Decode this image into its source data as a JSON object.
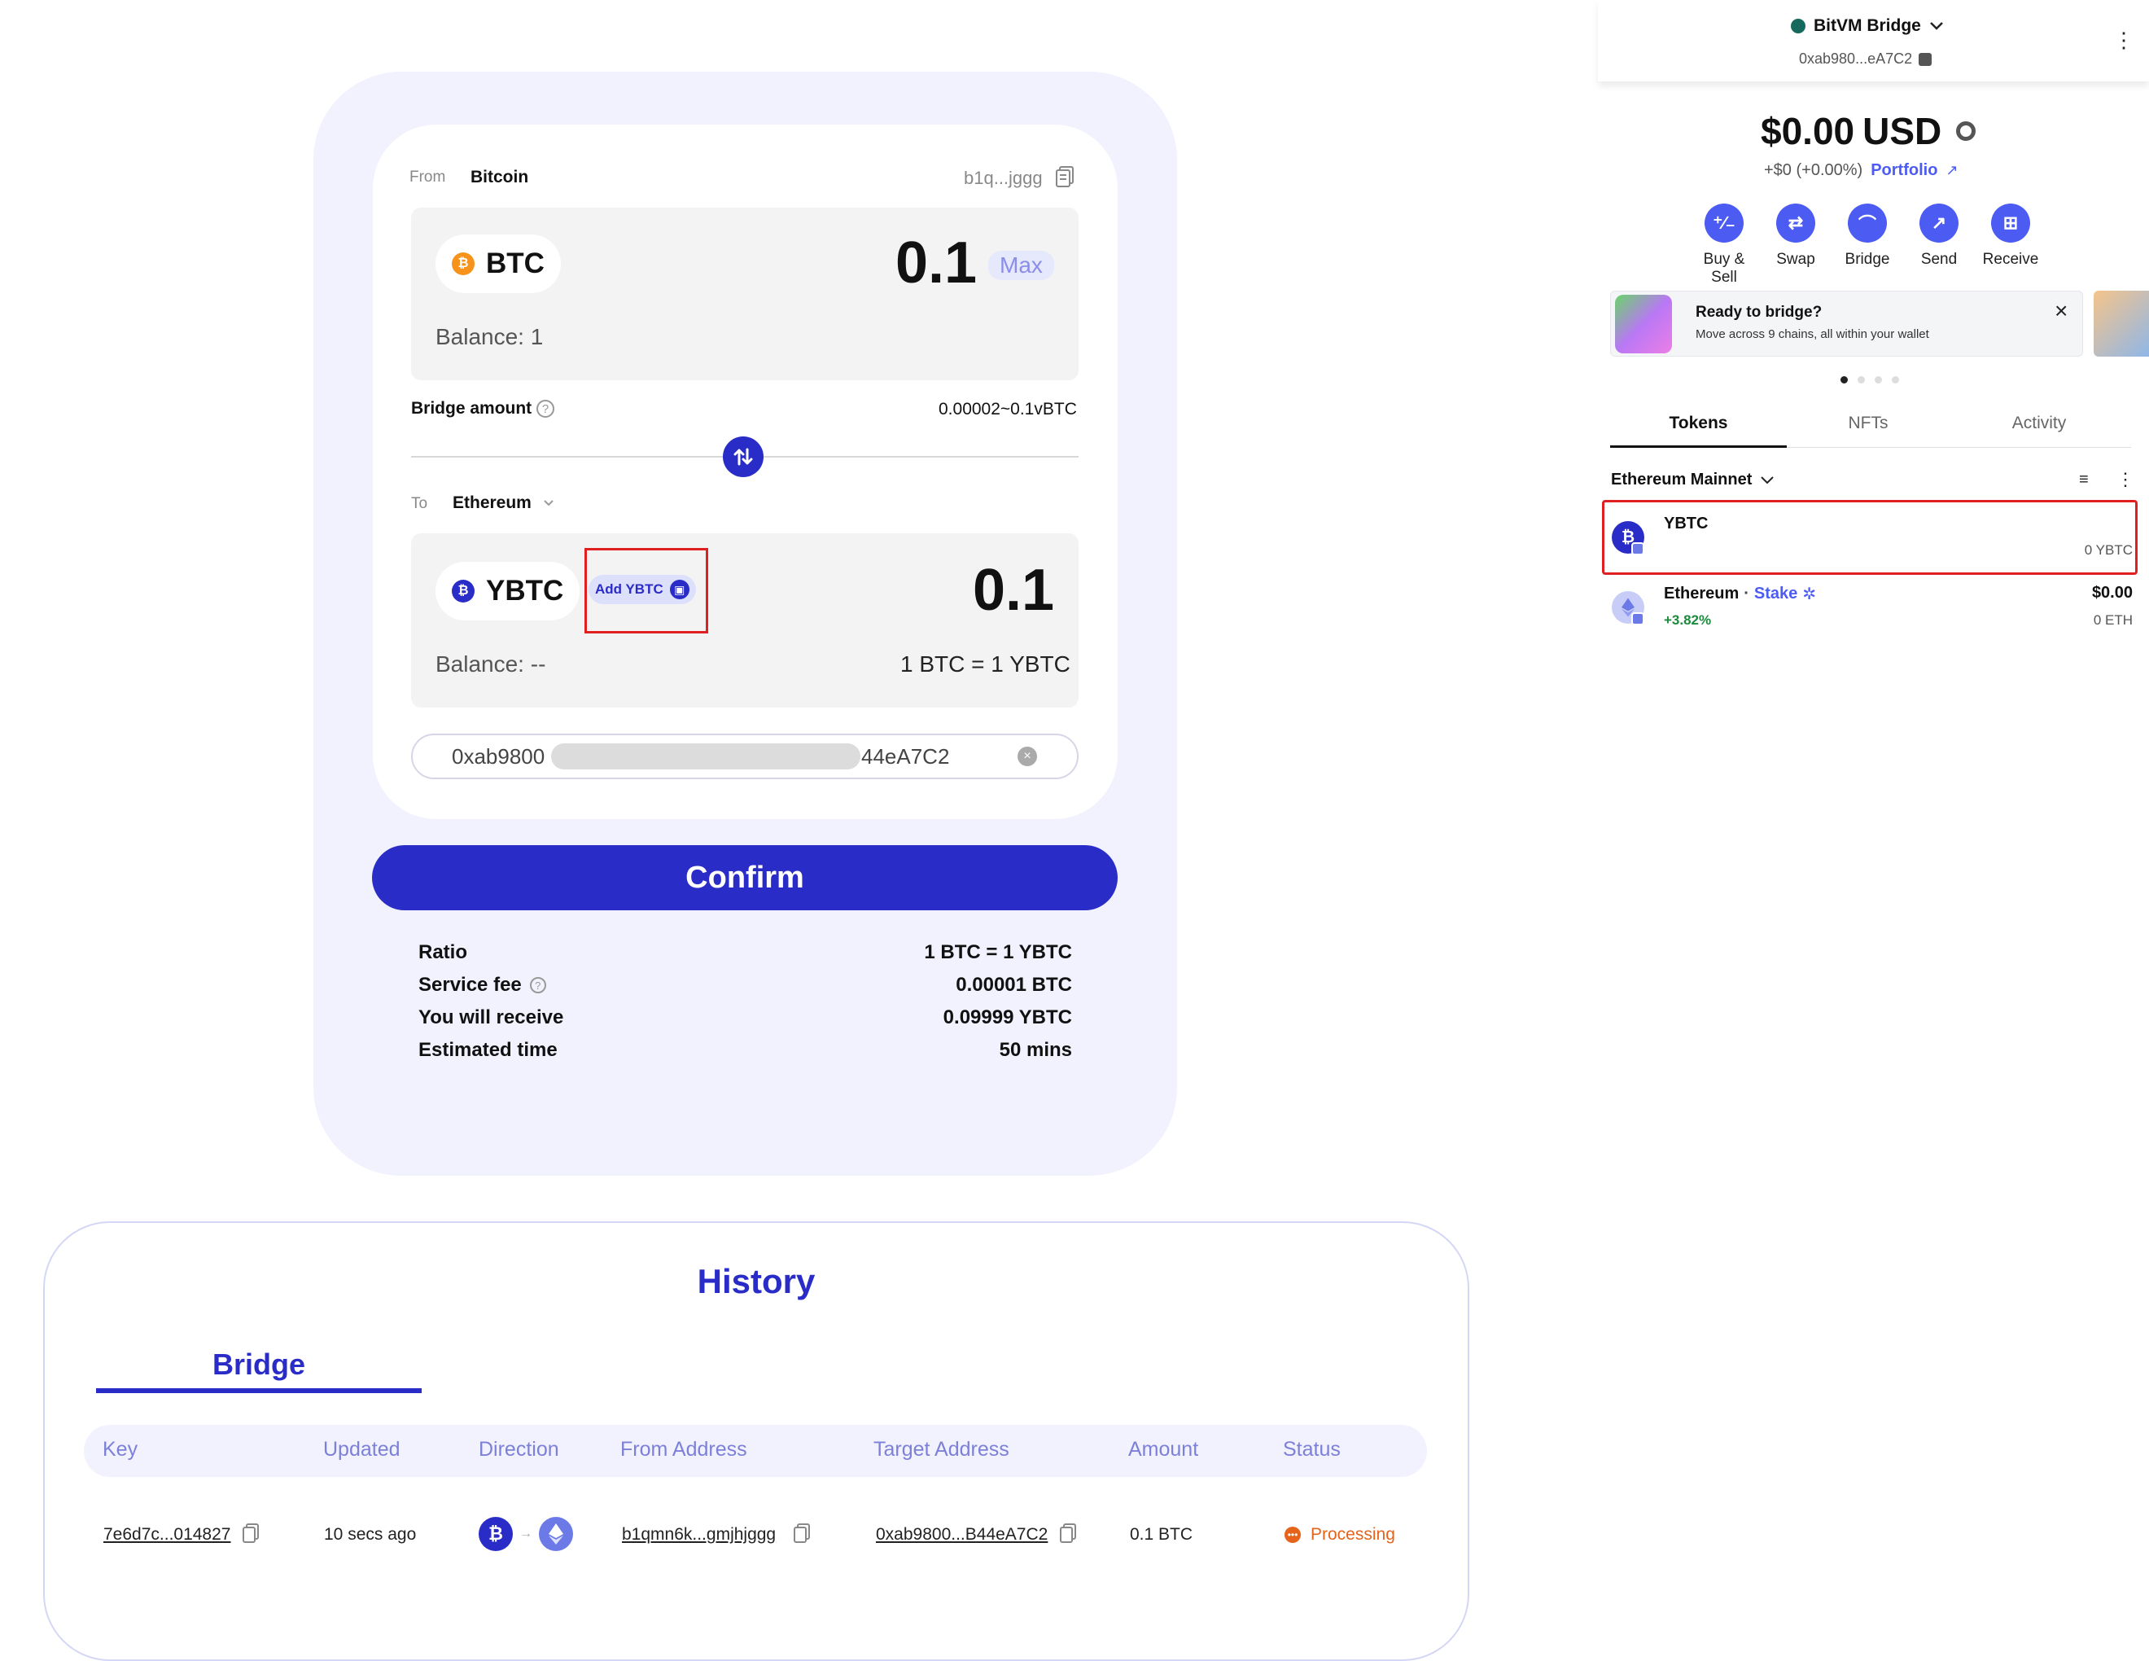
{
  "bridge": {
    "from_label": "From",
    "from_chain": "Bitcoin",
    "from_address": "b1q...jggg",
    "from_token": "BTC",
    "from_amount": "0.1",
    "max_label": "Max",
    "from_balance": "Balance: 1",
    "bridge_amount_label": "Bridge amount",
    "bridge_range": "0.00002~0.1vBTC",
    "to_label": "To",
    "to_chain": "Ethereum",
    "to_token": "YBTC",
    "add_token_label": "Add YBTC",
    "to_amount": "0.1",
    "to_balance": "Balance: --",
    "rate": "1 BTC = 1 YBTC",
    "recipient_prefix": "0xab9800",
    "recipient_suffix": "44eA7C2",
    "confirm_label": "Confirm"
  },
  "summary": [
    {
      "label": "Ratio",
      "value": "1 BTC = 1 YBTC"
    },
    {
      "label": "Service fee",
      "value": "0.00001 BTC"
    },
    {
      "label": "You will receive",
      "value": "0.09999 YBTC"
    },
    {
      "label": "Estimated time",
      "value": "50 mins"
    }
  ],
  "history": {
    "title": "History",
    "tab": "Bridge",
    "columns": [
      "Key",
      "Updated",
      "Direction",
      "From Address",
      "Target Address",
      "Amount",
      "Status"
    ],
    "rows": [
      {
        "key": "7e6d7c...014827",
        "updated": "10 secs ago",
        "from_address": "b1qmn6k...gmjhjggg",
        "target_address": "0xab9800...B44eA7C2",
        "amount": "0.1 BTC",
        "status": "Processing"
      }
    ]
  },
  "wallet": {
    "network_name": "BitVM Bridge",
    "account_address": "0xab980...eA7C2",
    "balance": "$0.00",
    "currency": "USD",
    "change": "+$0 (+0.00%)",
    "portfolio_label": "Portfolio",
    "actions": [
      {
        "label": "Buy & Sell",
        "icon": "buy-sell-icon"
      },
      {
        "label": "Swap",
        "icon": "swap-icon"
      },
      {
        "label": "Bridge",
        "icon": "bridge-icon"
      },
      {
        "label": "Send",
        "icon": "send-icon"
      },
      {
        "label": "Receive",
        "icon": "receive-icon"
      }
    ],
    "banner_title": "Ready to bridge?",
    "banner_text": "Move across 9 chains, all within your wallet",
    "tabs": [
      "Tokens",
      "NFTs",
      "Activity"
    ],
    "network_filter": "Ethereum Mainnet",
    "tokens": [
      {
        "name": "YBTC",
        "balance": "0 YBTC",
        "value": "",
        "change": ""
      },
      {
        "name": "Ethereum",
        "stake_label": "Stake",
        "change": "+3.82%",
        "value": "$0.00",
        "balance": "0 ETH"
      }
    ]
  },
  "colors": {
    "brand": "#2a2cc7",
    "wallet_accent": "#4c5cf3",
    "btc_orange": "#f7931a",
    "processing": "#e5631a",
    "highlight_red": "#e02020"
  }
}
